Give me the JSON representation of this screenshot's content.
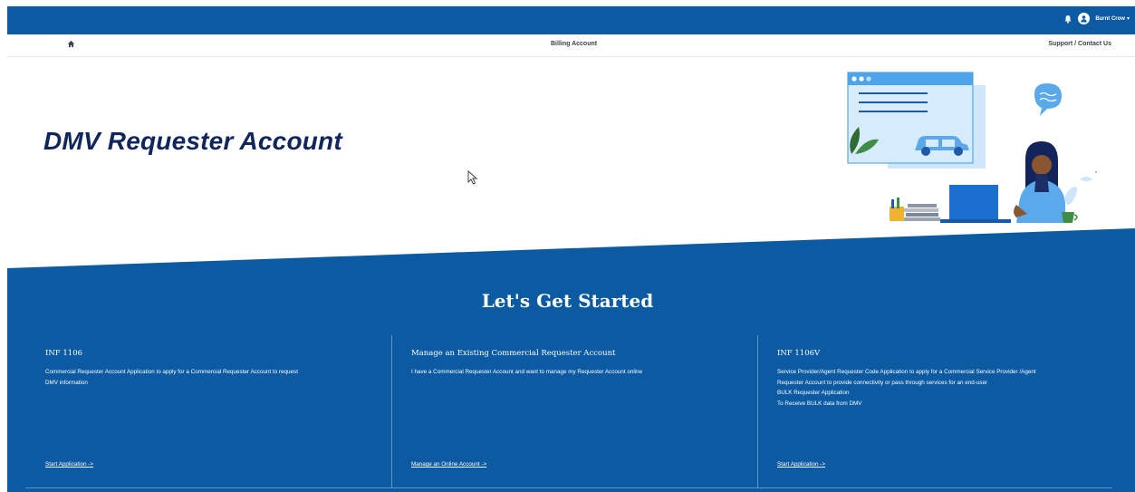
{
  "topbar": {
    "user_name": "Burnt Crow",
    "caret": "▾",
    "color": "#0b5aa2"
  },
  "nav": {
    "home_icon": "home-icon",
    "billing_label": "Billing Account",
    "support_label": "Support / Contact Us"
  },
  "hero": {
    "title": "DMV Requester Account"
  },
  "section": {
    "title": "Let's Get Started",
    "background": "#0b5aa2"
  },
  "cards": [
    {
      "title": "INF 1106",
      "lines": [
        "Commercial Requester Account Application  to apply for a Commercial Requester Account to request",
        "DMV information"
      ],
      "link": "Start Application ->"
    },
    {
      "title": "Manage an Existing Commercial Requester Account",
      "lines": [
        "I have a Commercial Requester Account and want to manage my Requester Account online"
      ],
      "link": "Manage an Online Account ->"
    },
    {
      "title": "INF 1106V",
      "lines": [
        "Service Provider/Agent Requester Code Application to apply for a Commercial Service Provider /Agent",
        "Requester Account to provide connectivity or pass through services for an end-user",
        "BULK Requester Application",
        "To Receive BULK data from DMV"
      ],
      "link": "Start Application ->"
    }
  ]
}
